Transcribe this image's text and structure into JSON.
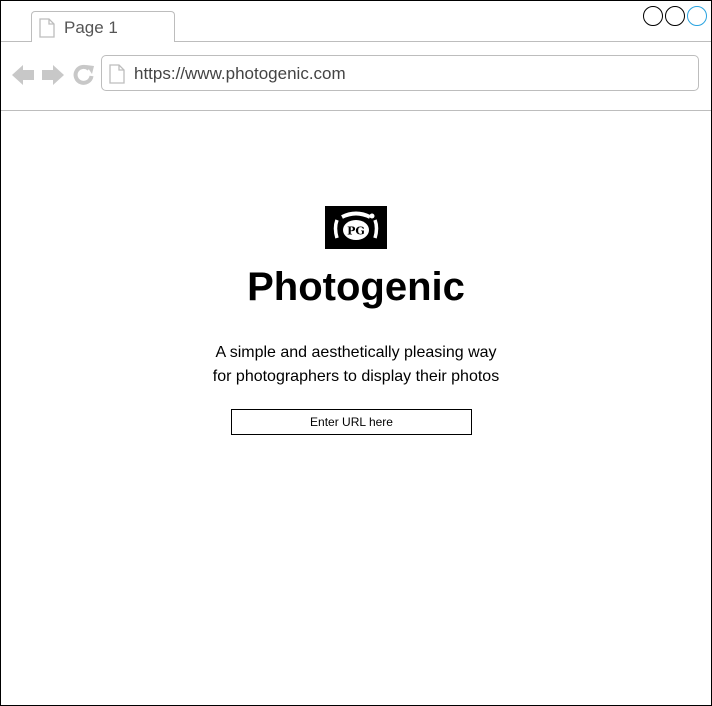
{
  "browser": {
    "tab": {
      "label": "Page 1",
      "icon": "page-icon"
    },
    "window_controls": [
      "circle",
      "circle",
      "circle"
    ],
    "window_control_active_color": "#29a3e0",
    "nav": {
      "back_icon": "back-arrow-icon",
      "forward_icon": "forward-arrow-icon",
      "reload_icon": "reload-icon"
    },
    "address": "https://www.photogenic.com"
  },
  "page": {
    "logo": {
      "icon": "camera-logo-icon",
      "text": "PG"
    },
    "title": "Photogenic",
    "tagline_line1": "A simple and aesthetically pleasing way",
    "tagline_line2": "for photographers to display their photos",
    "url_input": {
      "placeholder": "Enter URL here",
      "value": ""
    }
  }
}
